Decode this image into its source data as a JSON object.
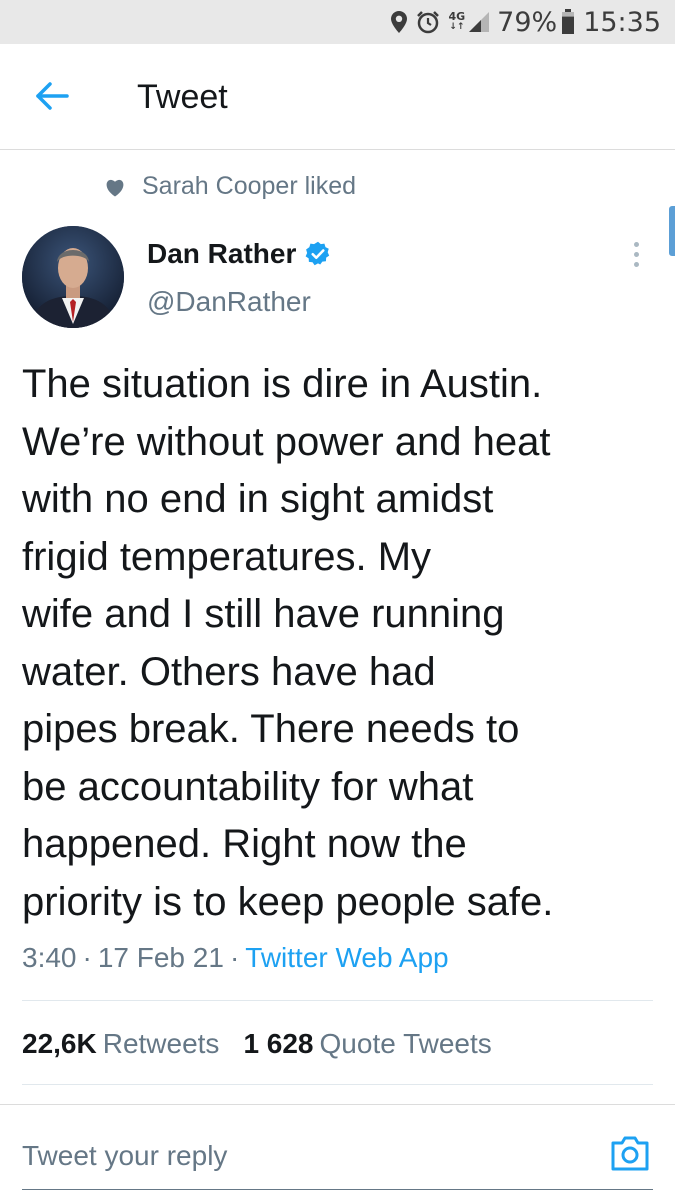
{
  "status_bar": {
    "network_top": "4G",
    "network_bottom": "↓↑",
    "battery_percent": "79%",
    "time": "15:35",
    "battery_level": 0.79
  },
  "header": {
    "title": "Tweet"
  },
  "social_context": {
    "text": "Sarah Cooper liked"
  },
  "tweet": {
    "author_name": "Dan Rather",
    "author_handle": "@DanRather",
    "verified": true,
    "text_lines": [
      "The situation is dire in Austin.",
      "We’re without power and heat",
      "with no end in sight amidst",
      "frigid temperatures. My",
      "wife and I still have running",
      "water. Others have had",
      "pipes break. There needs to",
      "be accountability for what",
      "happened. Right now the",
      "priority is to keep people safe."
    ],
    "time": "3:40",
    "date": "17 Feb 21",
    "source": "Twitter Web App",
    "separator": "·"
  },
  "stats": {
    "retweets_count": "22,6K",
    "retweets_label": "Retweets",
    "quotes_count": "1 628",
    "quotes_label": "Quote Tweets"
  },
  "reply": {
    "placeholder": "Tweet your reply"
  },
  "icons": {
    "back": "arrow-left-icon",
    "heart": "heart-icon",
    "verified": "verified-badge-icon",
    "more": "more-vertical-icon",
    "camera": "camera-icon",
    "location": "location-icon",
    "alarm": "alarm-icon",
    "signal": "signal-icon",
    "battery": "battery-icon"
  },
  "colors": {
    "accent": "#1da1f2",
    "secondary_text": "#657786",
    "primary_text": "#14171a",
    "status_bar_bg": "#e8e8e8"
  }
}
